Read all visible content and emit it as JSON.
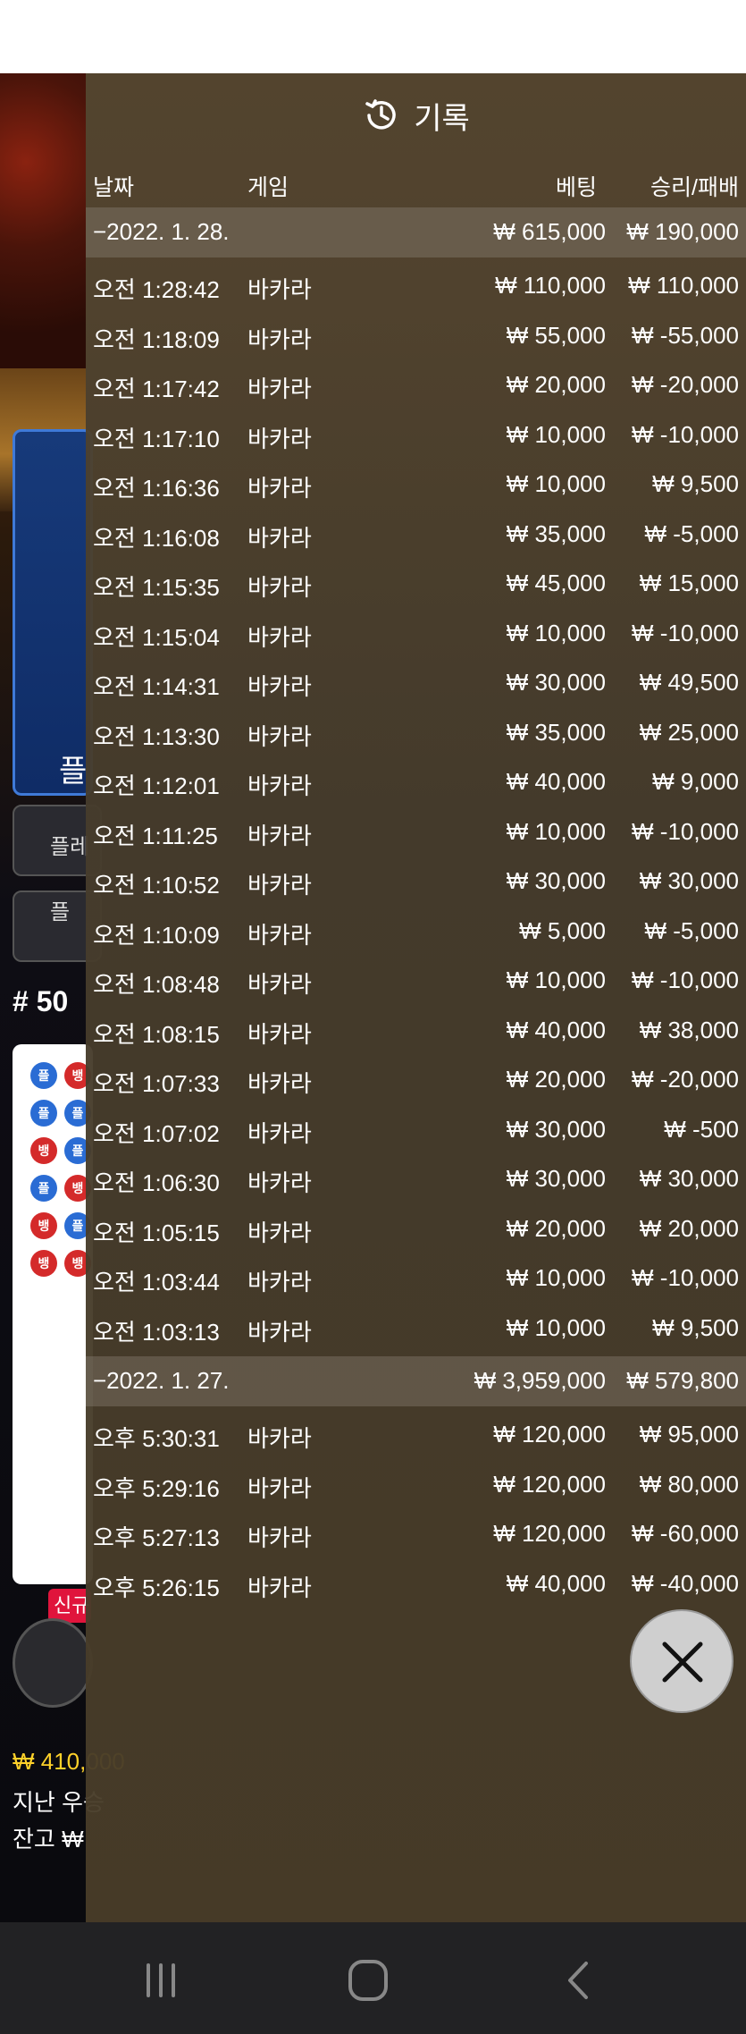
{
  "background": {
    "left_blue_text": "플",
    "left_btn1": "플레",
    "left_btn2": "플",
    "round_label": "# 50",
    "badge": "신규",
    "line1": "₩ 410,000",
    "line2": "지난 우승",
    "line3": "잔고 ₩"
  },
  "panel": {
    "title": "기록",
    "headers": {
      "date": "날짜",
      "game": "게임",
      "bet": "베팅",
      "result": "승리/패배"
    },
    "groups": [
      {
        "date": "−2022. 1. 28.",
        "total_bet": "₩ 615,000",
        "total_result": "₩ 190,000",
        "rows": [
          {
            "time": "오전 1:28:42",
            "game": "바카라",
            "bet": "₩ 110,000",
            "result": "₩ 110,000"
          },
          {
            "time": "오전 1:18:09",
            "game": "바카라",
            "bet": "₩ 55,000",
            "result": "₩ -55,000"
          },
          {
            "time": "오전 1:17:42",
            "game": "바카라",
            "bet": "₩ 20,000",
            "result": "₩ -20,000"
          },
          {
            "time": "오전 1:17:10",
            "game": "바카라",
            "bet": "₩ 10,000",
            "result": "₩ -10,000"
          },
          {
            "time": "오전 1:16:36",
            "game": "바카라",
            "bet": "₩ 10,000",
            "result": "₩ 9,500"
          },
          {
            "time": "오전 1:16:08",
            "game": "바카라",
            "bet": "₩ 35,000",
            "result": "₩ -5,000"
          },
          {
            "time": "오전 1:15:35",
            "game": "바카라",
            "bet": "₩ 45,000",
            "result": "₩ 15,000"
          },
          {
            "time": "오전 1:15:04",
            "game": "바카라",
            "bet": "₩ 10,000",
            "result": "₩ -10,000"
          },
          {
            "time": "오전 1:14:31",
            "game": "바카라",
            "bet": "₩ 30,000",
            "result": "₩ 49,500"
          },
          {
            "time": "오전 1:13:30",
            "game": "바카라",
            "bet": "₩ 35,000",
            "result": "₩ 25,000"
          },
          {
            "time": "오전 1:12:01",
            "game": "바카라",
            "bet": "₩ 40,000",
            "result": "₩ 9,000"
          },
          {
            "time": "오전 1:11:25",
            "game": "바카라",
            "bet": "₩ 10,000",
            "result": "₩ -10,000"
          },
          {
            "time": "오전 1:10:52",
            "game": "바카라",
            "bet": "₩ 30,000",
            "result": "₩ 30,000"
          },
          {
            "time": "오전 1:10:09",
            "game": "바카라",
            "bet": "₩ 5,000",
            "result": "₩ -5,000"
          },
          {
            "time": "오전 1:08:48",
            "game": "바카라",
            "bet": "₩ 10,000",
            "result": "₩ -10,000"
          },
          {
            "time": "오전 1:08:15",
            "game": "바카라",
            "bet": "₩ 40,000",
            "result": "₩ 38,000"
          },
          {
            "time": "오전 1:07:33",
            "game": "바카라",
            "bet": "₩ 20,000",
            "result": "₩ -20,000"
          },
          {
            "time": "오전 1:07:02",
            "game": "바카라",
            "bet": "₩ 30,000",
            "result": "₩ -500"
          },
          {
            "time": "오전 1:06:30",
            "game": "바카라",
            "bet": "₩ 30,000",
            "result": "₩ 30,000"
          },
          {
            "time": "오전 1:05:15",
            "game": "바카라",
            "bet": "₩ 20,000",
            "result": "₩ 20,000"
          },
          {
            "time": "오전 1:03:44",
            "game": "바카라",
            "bet": "₩ 10,000",
            "result": "₩ -10,000"
          },
          {
            "time": "오전 1:03:13",
            "game": "바카라",
            "bet": "₩ 10,000",
            "result": "₩ 9,500"
          }
        ]
      },
      {
        "date": "−2022. 1. 27.",
        "total_bet": "₩ 3,959,000",
        "total_result": "₩ 579,800",
        "rows": [
          {
            "time": "오후 5:30:31",
            "game": "바카라",
            "bet": "₩ 120,000",
            "result": "₩ 95,000"
          },
          {
            "time": "오후 5:29:16",
            "game": "바카라",
            "bet": "₩ 120,000",
            "result": "₩ 80,000"
          },
          {
            "time": "오후 5:27:13",
            "game": "바카라",
            "bet": "₩ 120,000",
            "result": "₩ -60,000"
          },
          {
            "time": "오후 5:26:15",
            "game": "바카라",
            "bet": "₩ 40,000",
            "result": "₩ -40,000"
          }
        ]
      }
    ]
  },
  "icons": {
    "header": "history-icon",
    "close": "close-icon",
    "nav": [
      "recent-apps-icon",
      "home-icon",
      "back-icon"
    ]
  }
}
